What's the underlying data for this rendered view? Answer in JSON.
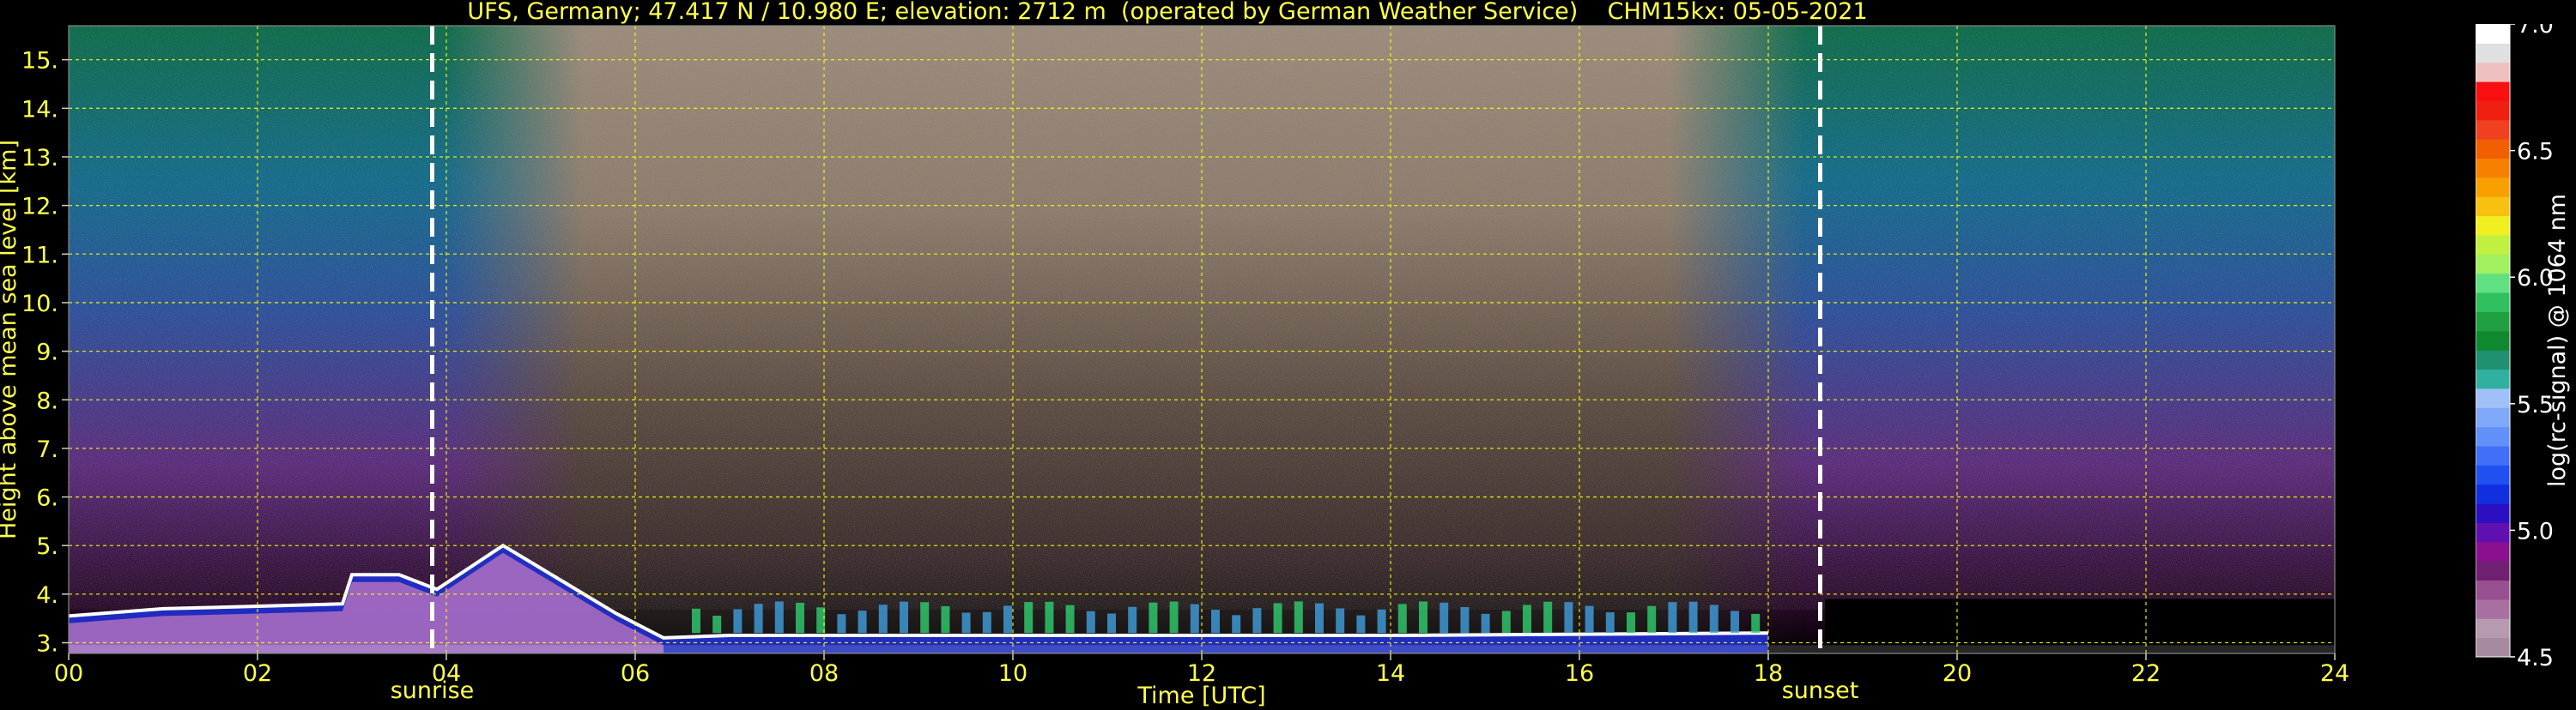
{
  "chart_data": {
    "type": "heatmap",
    "title": "UFS, Germany; 47.417 N / 10.980 E; elevation: 2712 m  (operated by German Weather Service)    CHM15kx: 05-05-2021",
    "xlabel": "Time [UTC]",
    "ylabel": "Height above mean sea level [km]",
    "xlim": [
      0,
      24
    ],
    "ylim": [
      2.78,
      15.7
    ],
    "x_ticks": [
      0,
      2,
      4,
      6,
      8,
      10,
      12,
      14,
      16,
      18,
      20,
      22,
      24
    ],
    "x_tick_labels": [
      "00",
      "02",
      "04",
      "06",
      "08",
      "10",
      "12",
      "14",
      "16",
      "18",
      "20",
      "22",
      "24"
    ],
    "y_ticks": [
      3,
      4,
      5,
      6,
      7,
      8,
      9,
      10,
      11,
      12,
      13,
      14,
      15
    ],
    "y_tick_labels": [
      "3.",
      "4.",
      "5.",
      "6.",
      "7.",
      "8.",
      "9.",
      "10.",
      "11.",
      "12.",
      "13.",
      "14.",
      "15."
    ],
    "grid": true,
    "annotations": [
      {
        "text": "sunrise",
        "x": 3.85
      },
      {
        "text": "sunset",
        "x": 18.55
      }
    ],
    "colorbar": {
      "label": "log(rc-signal) @ 1064 nm",
      "range": [
        4.5,
        7.0
      ],
      "ticks": [
        4.5,
        5.0,
        5.5,
        6.0,
        6.5,
        7.0
      ],
      "tick_labels": [
        "4.5",
        "5.0",
        "5.5",
        "6.0",
        "6.5",
        "7.0"
      ]
    },
    "boundary_layer_top_km": [
      {
        "x": 0.0,
        "y": 3.55
      },
      {
        "x": 1.0,
        "y": 3.7
      },
      {
        "x": 2.0,
        "y": 3.75
      },
      {
        "x": 2.9,
        "y": 3.8
      },
      {
        "x": 3.0,
        "y": 4.4
      },
      {
        "x": 3.5,
        "y": 4.4
      },
      {
        "x": 3.9,
        "y": 4.1
      },
      {
        "x": 4.6,
        "y": 5.0
      },
      {
        "x": 5.2,
        "y": 4.3
      },
      {
        "x": 5.8,
        "y": 3.6
      },
      {
        "x": 6.3,
        "y": 3.1
      },
      {
        "x": 7.0,
        "y": 3.15
      },
      {
        "x": 10.0,
        "y": 3.15
      },
      {
        "x": 14.0,
        "y": 3.15
      },
      {
        "x": 18.0,
        "y": 3.2
      }
    ]
  },
  "colors": {
    "text": "#ffff4a",
    "axis_text_right": "#ffffff",
    "grid": "#ffff00",
    "background": "#000000"
  }
}
